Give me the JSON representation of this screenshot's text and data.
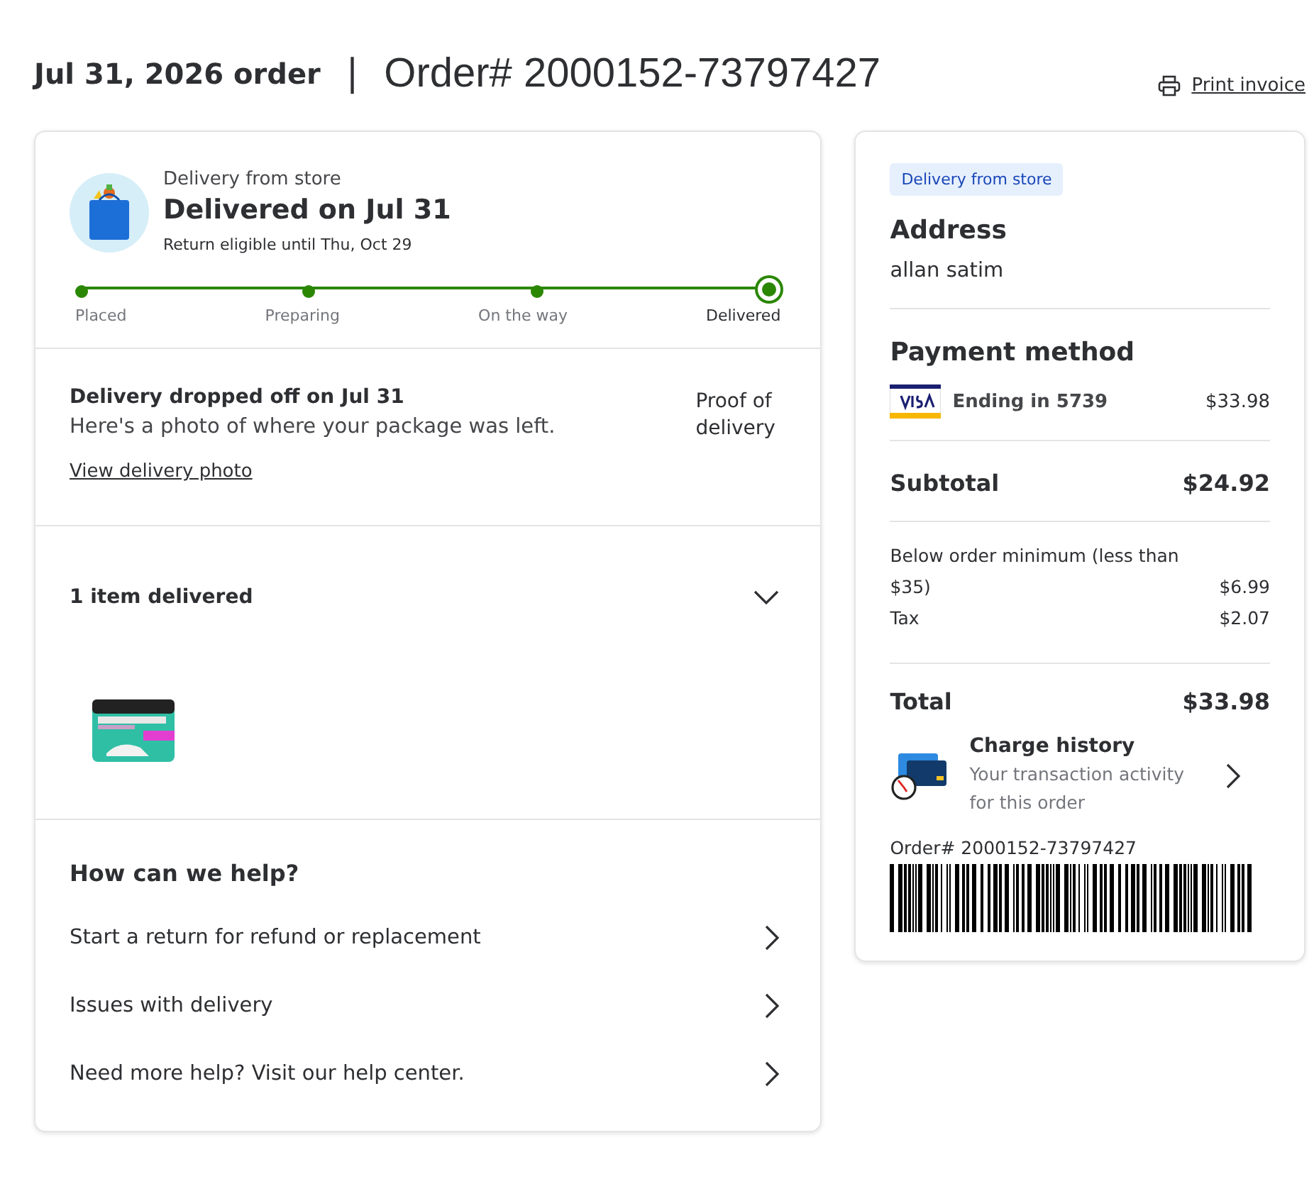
{
  "header": {
    "date_title": "Jul 31, 2026 order",
    "separator": "|",
    "order_number": "Order# 2000152-73797427",
    "print_link": "Print invoice"
  },
  "status": {
    "subtitle": "Delivery from store",
    "title": "Delivered on Jul 31",
    "return_note": "Return eligible until Thu, Oct 29",
    "steps": [
      {
        "label": "Placed",
        "done": true,
        "current": false
      },
      {
        "label": "Preparing",
        "done": true,
        "current": false
      },
      {
        "label": "On the way",
        "done": true,
        "current": false
      },
      {
        "label": "Delivered",
        "done": true,
        "current": true
      }
    ]
  },
  "drop_off": {
    "title": "Delivery dropped off on Jul 31",
    "text": "Here's a photo of where your package was left.",
    "link": "View delivery photo",
    "photo_alt": "Proof of delivery"
  },
  "items": {
    "title": "1 item delivered",
    "expanded": false
  },
  "help": {
    "title": "How can we help?",
    "options": [
      "Start a return for refund or replacement",
      "Issues with delivery",
      "Need more help? Visit our help center."
    ]
  },
  "summary": {
    "tag": "Delivery from store",
    "address_title": "Address",
    "address": "allan satim",
    "payment_title": "Payment method",
    "card_label": "Ending in 5739",
    "card_amount": "$33.98",
    "subtotal_label": "Subtotal",
    "subtotal": "$24.92",
    "fees": [
      {
        "label": "Below order minimum (less than $35)",
        "amount": "$6.99"
      },
      {
        "label": "Tax",
        "amount": "$2.07"
      }
    ],
    "total_label": "Total",
    "total": "$33.98",
    "charge_title": "Charge history",
    "charge_text": "Your transaction activity for this order",
    "order_number": "Order# 2000152-73797427"
  }
}
